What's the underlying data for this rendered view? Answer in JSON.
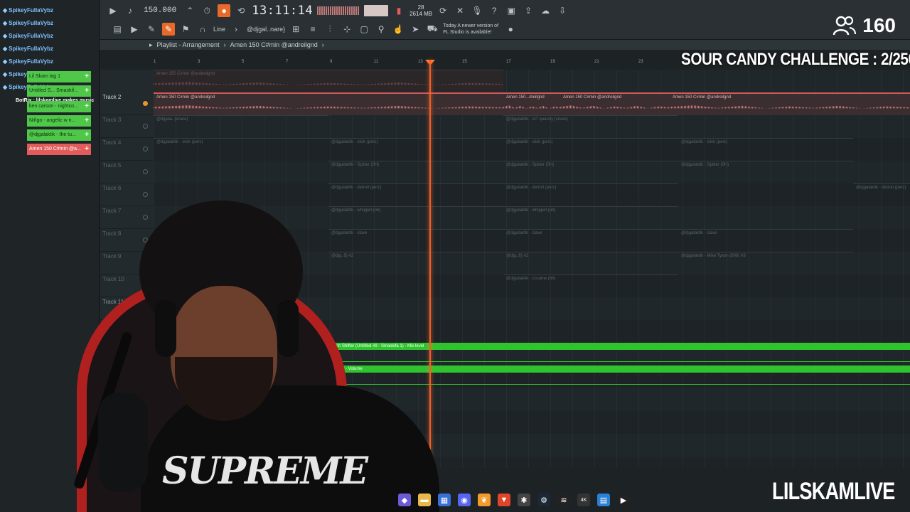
{
  "toolbar": {
    "tempo": "150.000",
    "clock": "13:11:14",
    "cpu_top": "28",
    "memory": "2614 MB",
    "snap_label": "Line",
    "pattern_name": "@djgal..nare}",
    "news_text": "Today A newer version of FL Studio is available!"
  },
  "chat": [
    "SpikeyFullaVybz",
    "SpikeyFullaVybz",
    "SpikeyFullaVybz",
    "SpikeyFullaVybz",
    "SpikeyFullaVybz",
    "SpikeyFullaVybz",
    "SpikeyFullaVybz"
  ],
  "chat_message": "BotRix : lilskamlive makes music",
  "patterns": [
    "Lil Skam lag 1",
    "Untitled S... Smaskif...",
    "ken carson - nightco...",
    "Niñgo - angelic w n...",
    "@djgalaktik - the tu...",
    "Amen 150 C#min @a..."
  ],
  "playlist": {
    "title": "Playlist - Arrangement",
    "pattern": "Amen 150 C#min @andreilgnd"
  },
  "ruler": [
    "1",
    "3",
    "5",
    "7",
    "9",
    "11",
    "13",
    "15",
    "17",
    "19",
    "21",
    "23",
    "25"
  ],
  "tracks": [
    "Track 2",
    "Track 3",
    "Track 4",
    "Track 5",
    "Track 6",
    "Track 7",
    "Track 8",
    "Track 9",
    "Track 10",
    "Track 11"
  ],
  "clips": {
    "audio_main": "Amen 150 C#min @andreilgnd",
    "audio_b": "Amen 150...dreilgnd",
    "audio_c": "Amen 150 C#min @andreilgnd",
    "audio_d": "Amen 150 C#min @andreilgnd",
    "perc": "@djgalaktik - click (perc)",
    "spider": "@djgalaktik - Spider (0H)",
    "detroit": "@djgalaktik - detroit (perc)",
    "whippet": "@djgalaktik - whippet (oh)",
    "clave": "@djgalaktik - clave",
    "snare1": "@djgala..(snare)",
    "snare2": "@djgalaktik - ot7 quanny (snare)",
    "cocaine": "@djgalaktik - cocaine (hh)",
    "bass": "@djg..8) #2",
    "mike": "@djgalaktik - Mike Tyson (808) #3"
  },
  "automation": {
    "pitch": "Pitch Shifter (Untitled #9 - Smaskifa 1) - Mix level",
    "master": "Master - Volume"
  },
  "overlay": {
    "viewers": "160",
    "challenge": "SOUR CANDY CHALLENGE : 2/250",
    "brand": "LILSKAMLIVE",
    "shirt": "SUPREME"
  }
}
